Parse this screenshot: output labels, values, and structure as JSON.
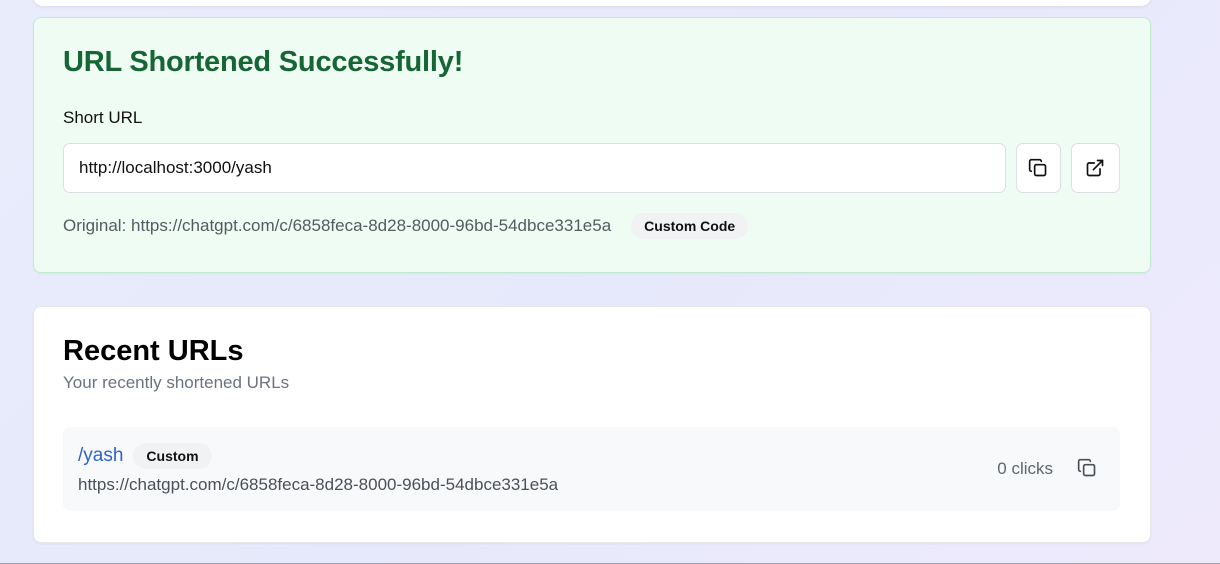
{
  "success": {
    "title": "URL Shortened Successfully!",
    "short_url_label": "Short URL",
    "short_url_value": "http://localhost:3000/yash",
    "copy_icon": "copy-icon",
    "open_icon": "external-link-icon",
    "original_text": "Original: https://chatgpt.com/c/6858feca-8d28-8000-96bd-54dbce331e5a",
    "badge": "Custom Code",
    "accent_color": "#166534",
    "background_color": "#effcf3"
  },
  "recent": {
    "title": "Recent URLs",
    "subtitle": "Your recently shortened URLs",
    "items": [
      {
        "short_path": "/yash",
        "badge": "Custom",
        "original": "https://chatgpt.com/c/6858feca-8d28-8000-96bd-54dbce331e5a",
        "clicks": "0 clicks",
        "copy_icon": "copy-icon"
      }
    ],
    "link_color": "#2f63c7"
  }
}
